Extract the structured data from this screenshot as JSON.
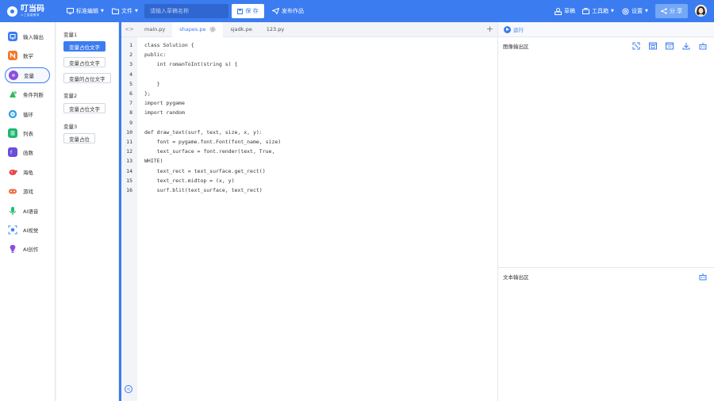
{
  "app": {
    "logo_name": "叮当码",
    "logo_sub": "人工智能教育"
  },
  "topbar": {
    "editor_mode": "标准编辑",
    "file_menu": "文件",
    "search_placeholder": "请输入草稿名称",
    "save_label": "保 存",
    "publish_label": "发布作品",
    "drafts_label": "草稿",
    "toolbox_label": "工具箱",
    "settings_label": "设置",
    "share_label": "分 享"
  },
  "sidebar": {
    "items": [
      {
        "label": "输入输出",
        "icon": "io-icon",
        "color": "#3b7cf0"
      },
      {
        "label": "数学",
        "icon": "math-icon",
        "color": "#f07a2b"
      },
      {
        "label": "变量",
        "icon": "variable-icon",
        "color": "#8b4de0",
        "active": true
      },
      {
        "label": "条件判断",
        "icon": "condition-icon",
        "color": "#2cb85c"
      },
      {
        "label": "循环",
        "icon": "loop-icon",
        "color": "#2b9de8"
      },
      {
        "label": "列表",
        "icon": "list-icon",
        "color": "#1fb86f"
      },
      {
        "label": "函数",
        "icon": "function-icon",
        "color": "#6a4fd8"
      },
      {
        "label": "海龟",
        "icon": "turtle-icon",
        "color": "#e84545"
      },
      {
        "label": "游戏",
        "icon": "game-icon",
        "color": "#f06a3a"
      },
      {
        "label": "AI语音",
        "icon": "ai-voice-icon",
        "color": "#2bb87a"
      },
      {
        "label": "AI视觉",
        "icon": "ai-vision-icon",
        "color": "#3b8cf0"
      },
      {
        "label": "AI创作",
        "icon": "ai-create-icon",
        "color": "#8b4de0"
      }
    ]
  },
  "blocks": {
    "groups": [
      {
        "title": "变量1",
        "chips": [
          "变量占位文字",
          "变量占位文字",
          "变量的占位文字"
        ]
      },
      {
        "title": "变量2",
        "chips": [
          "变量占位文字"
        ]
      },
      {
        "title": "变量3",
        "chips": [
          "变量占位"
        ]
      }
    ]
  },
  "editor": {
    "tabs": [
      "main.py",
      "shapes.pe",
      "sjadk.pe",
      "123.py"
    ],
    "active_tab": 1,
    "line_numbers": [
      "1",
      "2",
      "3",
      "4",
      "5",
      "6",
      "7",
      "8",
      "9",
      "10",
      "11",
      "12",
      "13",
      "14",
      "15",
      "16"
    ],
    "lines": [
      "class Solution {",
      "public:",
      "    int romanToInt(string s) {",
      "",
      "    }",
      "};",
      "import pygame",
      "import random",
      "",
      "def draw_text(surf, text, size, x, y):",
      "    font = pygame.font.Font(font_name, size)",
      "    text_surface = font.render(text, True,",
      "WHITE)",
      "    text_rect = text_surface.get_rect()",
      "    text_rect.midtop = (x, y)",
      "    surf.blit(text_surface, text_rect)"
    ]
  },
  "output": {
    "run_label": "运行",
    "image_output_title": "图像输出区",
    "text_output_title": "文本输出区"
  },
  "colors": {
    "accent": "#3b7cf0",
    "topbar": "#3b7cf0",
    "share": "#74a8f6"
  }
}
